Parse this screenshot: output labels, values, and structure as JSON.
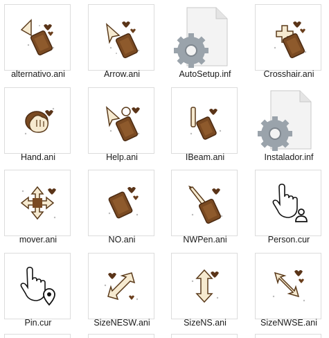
{
  "files": [
    {
      "name": "alternativo.ani",
      "icon": "choc-arrow-cursor-icon"
    },
    {
      "name": "Arrow.ani",
      "icon": "choc-arrow-cursor-icon"
    },
    {
      "name": "AutoSetup.inf",
      "icon": "settings-file-icon"
    },
    {
      "name": "Crosshair.ani",
      "icon": "choc-crosshair-cursor-icon"
    },
    {
      "name": "Hand.ani",
      "icon": "choc-hand-cursor-icon"
    },
    {
      "name": "Help.ani",
      "icon": "choc-help-cursor-icon"
    },
    {
      "name": "IBeam.ani",
      "icon": "choc-ibeam-cursor-icon"
    },
    {
      "name": "Instalador.inf",
      "icon": "settings-file-icon"
    },
    {
      "name": "mover.ani",
      "icon": "choc-move-cursor-icon"
    },
    {
      "name": "NO.ani",
      "icon": "choc-no-cursor-icon"
    },
    {
      "name": "NWPen.ani",
      "icon": "choc-pen-cursor-icon"
    },
    {
      "name": "Person.cur",
      "icon": "person-hand-cursor-icon"
    },
    {
      "name": "Pin.cur",
      "icon": "pin-hand-cursor-icon"
    },
    {
      "name": "SizeNESW.ani",
      "icon": "resize-nesw-cursor-icon"
    },
    {
      "name": "SizeNS.ani",
      "icon": "resize-ns-cursor-icon"
    },
    {
      "name": "SizeNWSE.ani",
      "icon": "resize-nwse-cursor-icon"
    }
  ],
  "colors": {
    "chocolate": "#7a4a22",
    "chocolate_dark": "#4a2a12",
    "cream": "#f6ead0",
    "gear": "#9aa3ab",
    "border": "#dcdcdc"
  }
}
